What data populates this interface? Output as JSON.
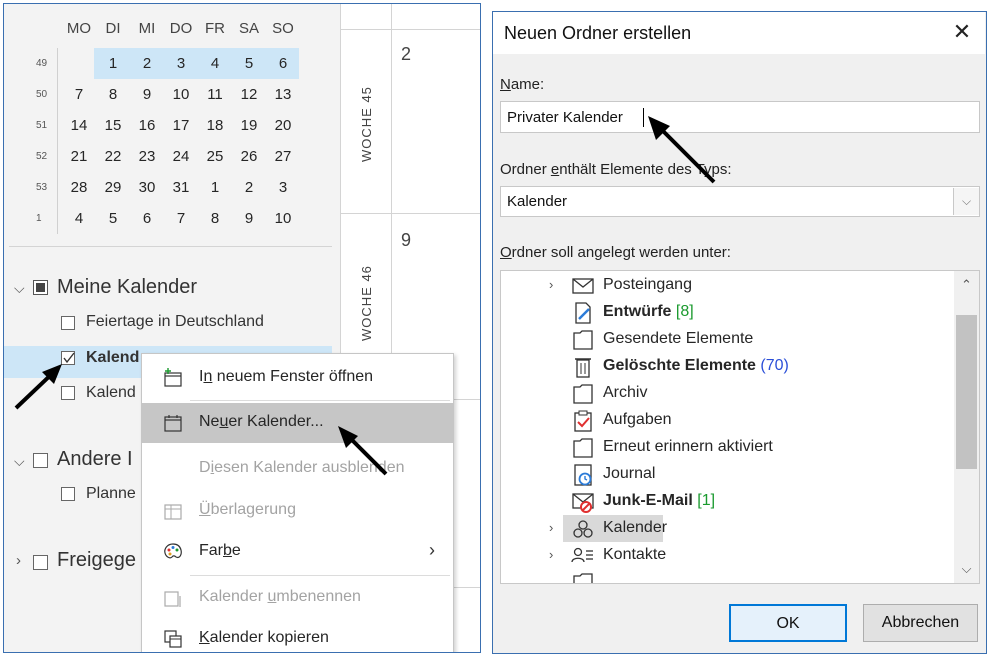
{
  "calendar": {
    "weekday_headers": [
      "MO",
      "DI",
      "MI",
      "DO",
      "FR",
      "SA",
      "SO"
    ],
    "weeks": [
      {
        "week": "49",
        "days": [
          "",
          "1",
          "2",
          "3",
          "4",
          "5",
          "6"
        ]
      },
      {
        "week": "50",
        "days": [
          "7",
          "8",
          "9",
          "10",
          "11",
          "12",
          "13"
        ]
      },
      {
        "week": "51",
        "days": [
          "14",
          "15",
          "16",
          "17",
          "18",
          "19",
          "20"
        ]
      },
      {
        "week": "52",
        "days": [
          "21",
          "22",
          "23",
          "24",
          "25",
          "26",
          "27"
        ]
      },
      {
        "week": "53",
        "days": [
          "28",
          "29",
          "30",
          "31",
          "1",
          "2",
          "3"
        ]
      },
      {
        "week": "1",
        "days": [
          "4",
          "5",
          "6",
          "7",
          "8",
          "9",
          "10"
        ]
      }
    ]
  },
  "nav": {
    "group_my": "Meine Kalender",
    "item_holidays": "Feiertage in Deutschland",
    "item_cal_1": "Kalend",
    "item_cal_2": "Kalend",
    "group_other": "Andere I",
    "item_planner": "Planne",
    "group_shared": "Freigege"
  },
  "week_view": {
    "weeks": [
      {
        "label": "WOCHE 45",
        "date": "2"
      },
      {
        "label": "WOCHE 46",
        "date": "9"
      }
    ]
  },
  "context_menu": {
    "items": [
      {
        "label": "In neuem Fenster öffnen",
        "underline": "n",
        "disabled": false
      },
      {
        "label": "Neuer Kalender...",
        "underline": "u",
        "disabled": false,
        "highlighted": true
      },
      {
        "label": "Diesen Kalender ausblenden",
        "underline": "i",
        "disabled": true
      },
      {
        "label": "Überlagerung",
        "underline": "Ü",
        "disabled": true
      },
      {
        "label": "Farbe",
        "underline": "b",
        "disabled": false,
        "submenu": true
      },
      {
        "label": "Kalender umbenennen",
        "underline": "u",
        "disabled": true
      },
      {
        "label": "Kalender kopieren",
        "underline": "K",
        "disabled": false
      }
    ]
  },
  "dialog": {
    "title": "Neuen Ordner erstellen",
    "name_label": "Name:",
    "name_value": "Privater Kalender",
    "type_label": "Ordner enthält Elemente des Typs:",
    "type_value": "Kalender",
    "location_label": "Ordner soll angelegt werden unter:",
    "folders": [
      {
        "label": "Posteingang",
        "count": "",
        "icon": "envelope-icon",
        "expandable": true
      },
      {
        "label": "Entwürfe",
        "count": "[8]",
        "icon": "draft-icon",
        "bold": true
      },
      {
        "label": "Gesendete Elemente",
        "count": "",
        "icon": "folder-icon"
      },
      {
        "label": "Gelöschte Elemente",
        "count": "(70)",
        "icon": "trash-icon",
        "bold": true
      },
      {
        "label": "Archiv",
        "count": "",
        "icon": "folder-icon"
      },
      {
        "label": "Aufgaben",
        "count": "",
        "icon": "task-icon"
      },
      {
        "label": "Erneut erinnern aktiviert",
        "count": "",
        "icon": "folder-icon"
      },
      {
        "label": "Journal",
        "count": "",
        "icon": "journal-icon"
      },
      {
        "label": "Junk-E-Mail",
        "count": "[1]",
        "icon": "junk-icon",
        "bold": true
      },
      {
        "label": "Kalender",
        "count": "",
        "icon": "calendar-folder-icon",
        "expandable": true,
        "selected": true
      },
      {
        "label": "Kontakte",
        "count": "",
        "icon": "contacts-icon",
        "expandable": true
      }
    ],
    "ok_label": "OK",
    "cancel_label": "Abbrechen"
  },
  "colors": {
    "selection_blue": "#cde6f7",
    "accent_border": "#3a6fb0",
    "count_green": "#1a9a2e",
    "count_blue": "#2b4fd8",
    "ok_border": "#0078d7"
  }
}
